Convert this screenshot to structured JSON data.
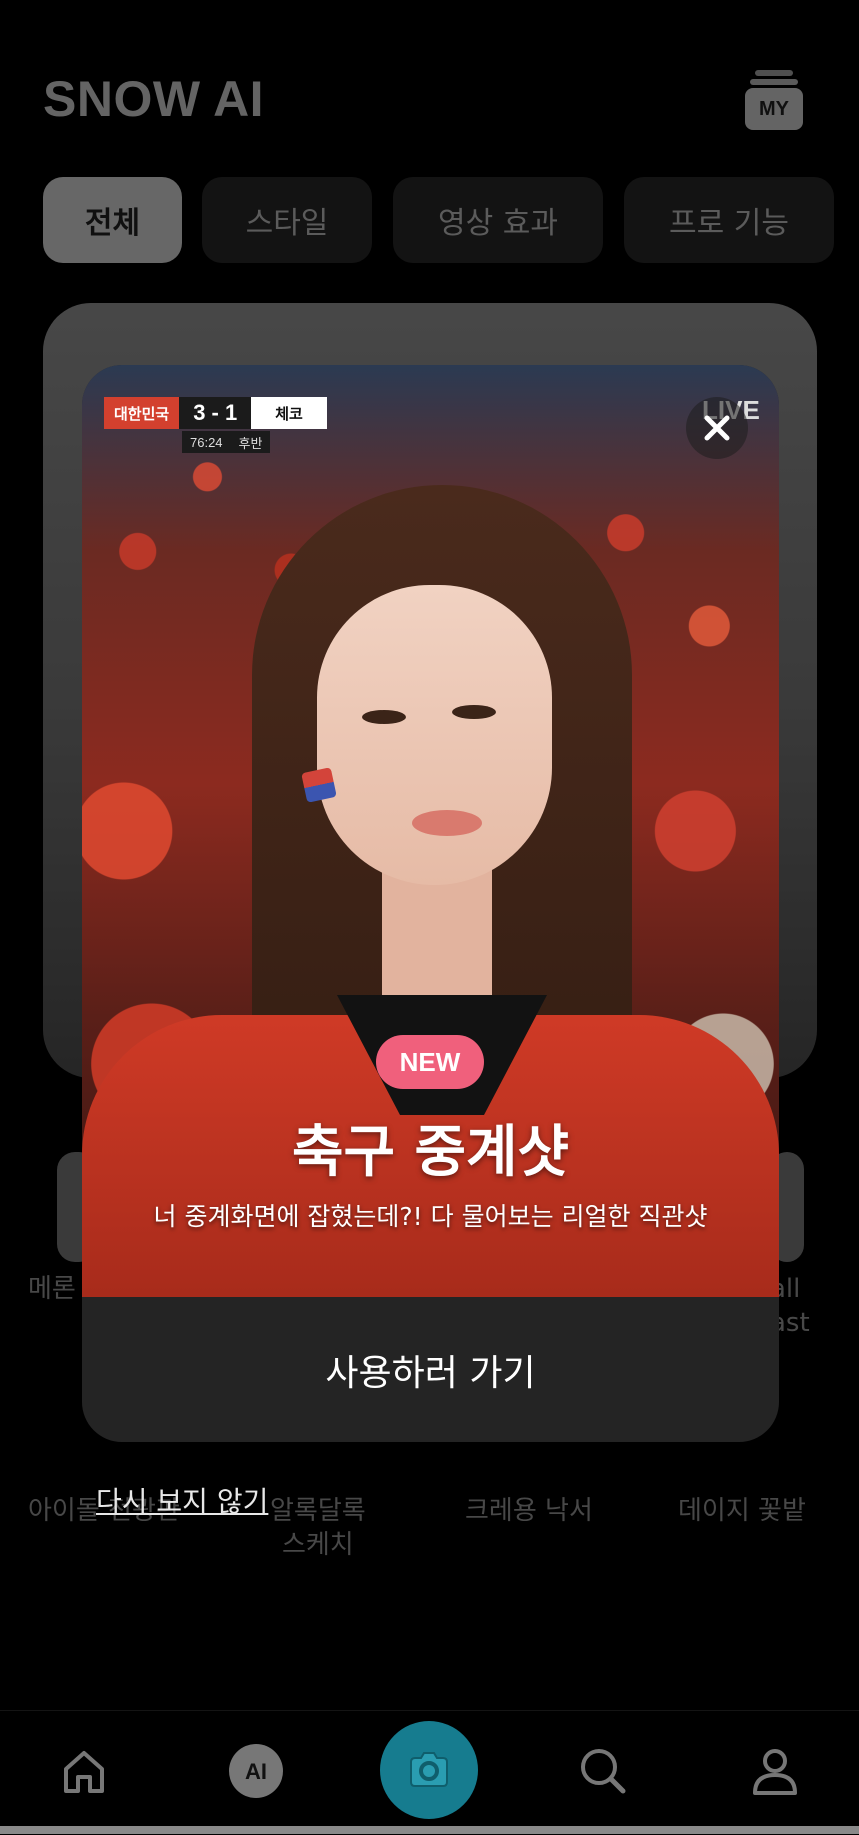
{
  "header": {
    "app_title": "SNOW AI",
    "my_label": "MY"
  },
  "tabs": [
    {
      "label": "전체",
      "active": true
    },
    {
      "label": "스타일",
      "active": false
    },
    {
      "label": "영상 효과",
      "active": false
    },
    {
      "label": "프로 기능",
      "active": false
    }
  ],
  "background_labels": {
    "row1_left": "메론",
    "row1_right": "all\nast",
    "row2": [
      "아이돌 전광판",
      "알록달록\n스케치",
      "크레용 낙서",
      "데이지 꽃밭"
    ]
  },
  "modal": {
    "scoreboard": {
      "home": "대한민국",
      "score": "3 - 1",
      "away": "체코",
      "clock": "76:24",
      "half": "후반"
    },
    "live_label": "LIVE",
    "badge": "NEW",
    "title": "축구 중계샷",
    "subtitle": "너 중계화면에 잡혔는데?! 다 물어보는 리얼한 직관샷",
    "cta_label": "사용하러 가기"
  },
  "dont_show_again": "다시 보지 않기",
  "bottom_nav": {
    "icons": [
      "home-icon",
      "ai-icon",
      "camera-icon",
      "search-icon",
      "profile-icon"
    ],
    "ai_label": "AI"
  },
  "colors": {
    "accent_camera": "#167c8f",
    "new_badge": "#f0607c",
    "score_red": "#d3402e"
  }
}
